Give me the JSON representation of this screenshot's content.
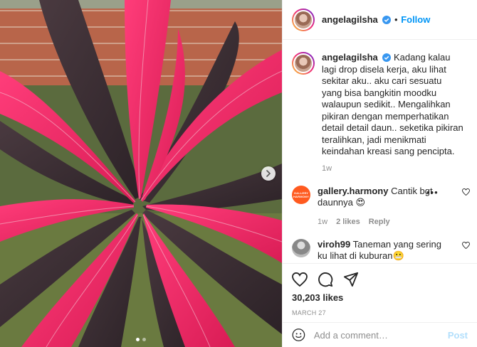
{
  "post": {
    "author": "angelagilsha",
    "follow_label": "Follow",
    "bullet": "•",
    "caption": "Kadang kalau lagi drop disela kerja, aku lihat sekitar aku.. aku cari sesuatu yang bisa bangkitin moodku walaupun sedikit.. Mengalihkan pikiran dengan memperhatikan detail detail daun.. seketika pikiran teralihkan, jadi menikmati keindahan kreasi sang pencipta.",
    "caption_time": "1w",
    "likes": "30,203 likes",
    "date": "MARCH 27",
    "photo_pages": 2,
    "photo_current_page": 1
  },
  "comments": [
    {
      "user": "gallery.harmony",
      "avatar_text": "GALLERY HARMONY",
      "text": "Cantik bgt daunnya 😍",
      "time": "1w",
      "likes": "2 likes",
      "reply": "Reply",
      "more": "•••"
    },
    {
      "user": "viroh99",
      "text": "Taneman yang sering ku lihat di kuburan😬"
    }
  ],
  "add_comment": {
    "placeholder": "Add a comment…",
    "post_label": "Post"
  },
  "icons": {
    "verified": "verified-badge-icon",
    "like": "heart-icon",
    "comment": "comment-icon",
    "share": "paper-plane-icon",
    "emoji": "emoji-icon",
    "next": "chevron-right-icon"
  },
  "colors": {
    "accent": "#0095f6",
    "leaf_pink": "#e8245e",
    "leaf_dark": "#3a2a30",
    "post_disabled": "#b2dffc"
  }
}
